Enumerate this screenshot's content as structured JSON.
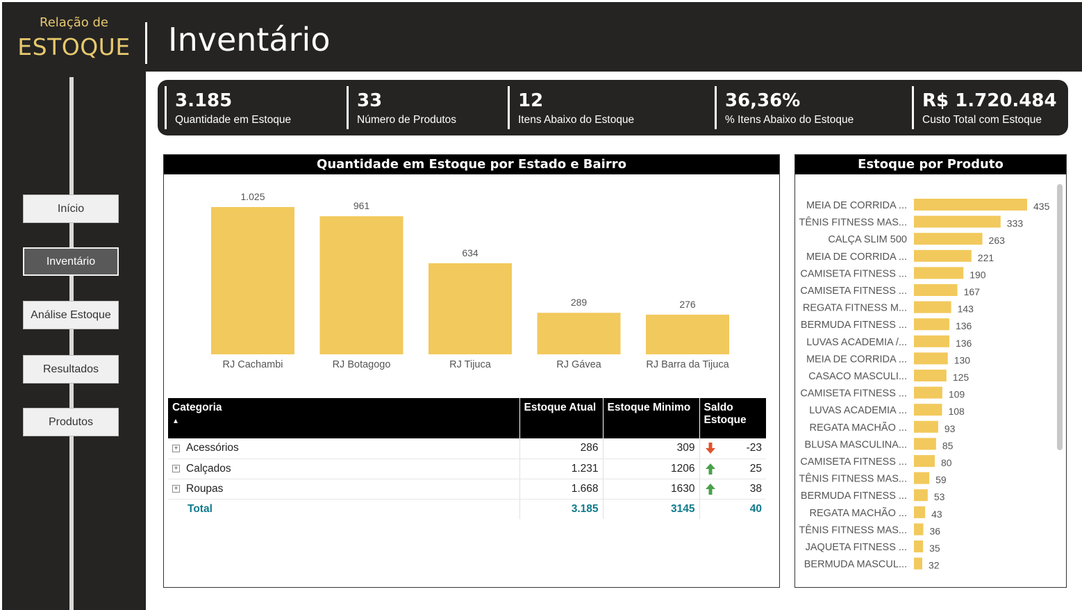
{
  "logo": {
    "line1": "Relação de",
    "line2": "ESTOQUE"
  },
  "page_title": "Inventário",
  "nav": [
    {
      "label": "Início",
      "active": false
    },
    {
      "label": "Inventário",
      "active": true
    },
    {
      "label": "Análise Estoque",
      "active": false
    },
    {
      "label": "Resultados",
      "active": false
    },
    {
      "label": "Produtos",
      "active": false
    }
  ],
  "kpis": [
    {
      "value": "3.185",
      "label": "Quantidade em Estoque"
    },
    {
      "value": "33",
      "label": "Número de Produtos"
    },
    {
      "value": "12",
      "label": "Itens Abaixo do Estoque"
    },
    {
      "value": "36,36%",
      "label": "% Itens Abaixo do Estoque"
    },
    {
      "value": "R$ 1.720.484",
      "label": "Custo Total com Estoque"
    }
  ],
  "colors": {
    "bar": "#f2c95c",
    "dark": "#252423",
    "accent_text": "#e7c96e",
    "total_text": "#0f7b8c",
    "up_arrow": "#4aa04a",
    "down_arrow": "#e0522e"
  },
  "chart_data": [
    {
      "type": "bar",
      "title": "Quantidade em Estoque por Estado e Bairro",
      "categories": [
        "RJ Cachambi",
        "RJ Botagogo",
        "RJ Tijuca",
        "RJ Gávea",
        "RJ Barra da Tijuca"
      ],
      "values": [
        1025,
        961,
        634,
        289,
        276
      ],
      "value_labels": [
        "1.025",
        "961",
        "634",
        "289",
        "276"
      ],
      "ylim": [
        0,
        1025
      ],
      "grid": false
    },
    {
      "type": "bar",
      "orientation": "horizontal",
      "title": "Estoque por Produto",
      "categories": [
        "MEIA DE CORRIDA ...",
        "TÊNIS FITNESS MAS...",
        "CALÇA SLIM 500",
        "MEIA DE CORRIDA ...",
        "CAMISETA FITNESS ...",
        "CAMISETA FITNESS ...",
        "REGATA FITNESS M...",
        "BERMUDA FITNESS ...",
        "LUVAS ACADEMIA /...",
        "MEIA DE CORRIDA ...",
        "CASACO MASCULI...",
        "CAMISETA FITNESS ...",
        "LUVAS ACADEMIA ...",
        "REGATA MACHÃO ...",
        "BLUSA MASCULINA...",
        "CAMISETA FITNESS ...",
        "TÊNIS FITNESS MAS...",
        "BERMUDA FITNESS ...",
        "REGATA MACHÃO ...",
        "TÊNIS FITNESS MAS...",
        "JAQUETA FITNESS ...",
        "BERMUDA MASCUL..."
      ],
      "values": [
        435,
        333,
        263,
        221,
        190,
        167,
        143,
        136,
        136,
        130,
        125,
        109,
        108,
        93,
        85,
        80,
        59,
        53,
        43,
        36,
        35,
        32
      ],
      "xlim": [
        0,
        435
      ],
      "grid": false
    }
  ],
  "table": {
    "headers": [
      "Categoria",
      "Estoque Atual",
      "Estoque Minimo",
      "Saldo Estoque"
    ],
    "sort_indicator": "▲",
    "rows": [
      {
        "category": "Acessórios",
        "atual": "286",
        "minimo": "309",
        "trend": "down",
        "saldo": "-23"
      },
      {
        "category": "Calçados",
        "atual": "1.231",
        "minimo": "1206",
        "trend": "up",
        "saldo": "25"
      },
      {
        "category": "Roupas",
        "atual": "1.668",
        "minimo": "1630",
        "trend": "up",
        "saldo": "38"
      }
    ],
    "total": {
      "label": "Total",
      "atual": "3.185",
      "minimo": "3145",
      "saldo": "40"
    }
  }
}
